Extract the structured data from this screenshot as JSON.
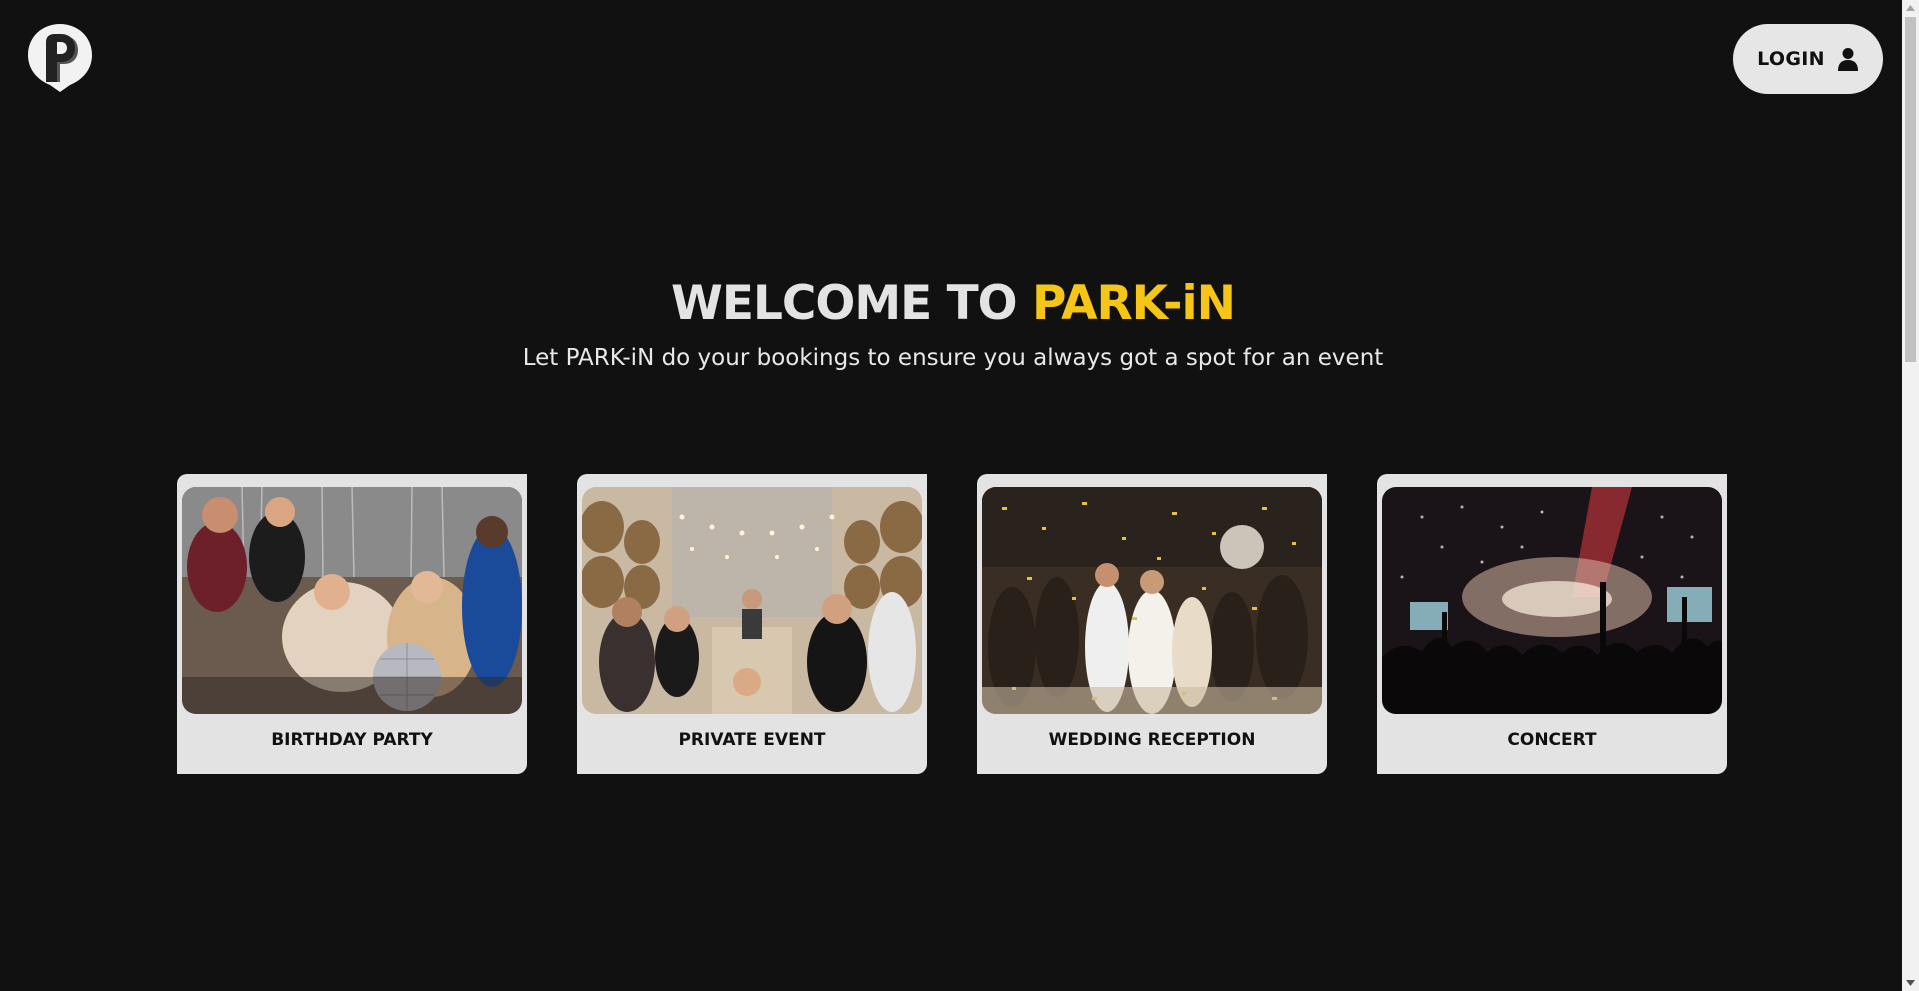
{
  "header": {
    "logo_icon": "park-in-pin-logo",
    "login_label": "LOGIN",
    "login_icon": "user-icon"
  },
  "hero": {
    "title_prefix": "WELCOME TO ",
    "title_brand": "PARK-iN",
    "subtitle": "Let PARK-iN do your bookings to ensure you always got a spot for an event"
  },
  "events": [
    {
      "label": "BIRTHDAY PARTY",
      "image": "birthday-party-photo"
    },
    {
      "label": "PRIVATE EVENT",
      "image": "private-event-photo"
    },
    {
      "label": "WEDDING RECEPTION",
      "image": "wedding-reception-photo"
    },
    {
      "label": "CONCERT",
      "image": "concert-photo"
    }
  ],
  "colors": {
    "background": "#111111",
    "brand_accent": "#f5c518",
    "card": "#e3e3e3",
    "heading": "#e3e3e3",
    "button": "#e6e6e6"
  }
}
